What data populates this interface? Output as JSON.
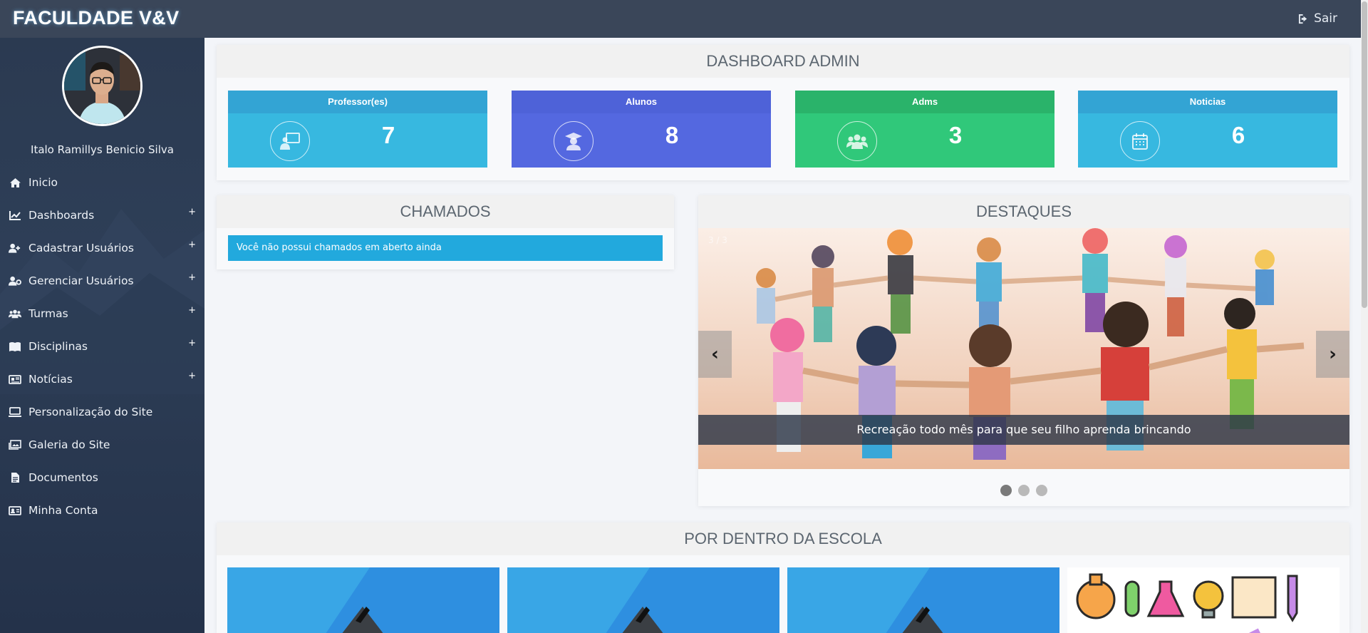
{
  "brand": "FACULDADE V&V",
  "logout_label": "Sair",
  "user": {
    "name": "Italo Ramillys Benicio Silva"
  },
  "menu": [
    {
      "label": "Inicio",
      "icon": "home-icon",
      "expandable": false
    },
    {
      "label": "Dashboards",
      "icon": "chart-line-icon",
      "expandable": true
    },
    {
      "label": "Cadastrar Usuários",
      "icon": "user-plus-icon",
      "expandable": true
    },
    {
      "label": "Gerenciar Usuários",
      "icon": "user-gear-icon",
      "expandable": true
    },
    {
      "label": "Turmas",
      "icon": "users-icon",
      "expandable": true
    },
    {
      "label": "Disciplinas",
      "icon": "book-icon",
      "expandable": true
    },
    {
      "label": "Notícias",
      "icon": "newspaper-icon",
      "expandable": true
    },
    {
      "label": "Personalização do Site",
      "icon": "laptop-icon",
      "expandable": false
    },
    {
      "label": "Galeria do Site",
      "icon": "gallery-icon",
      "expandable": false
    },
    {
      "label": "Documentos",
      "icon": "document-icon",
      "expandable": false
    },
    {
      "label": "Minha Conta",
      "icon": "id-card-icon",
      "expandable": false
    }
  ],
  "dashboard": {
    "title": "DASHBOARD ADMIN",
    "cards": [
      {
        "label": "Professor(es)",
        "value": "7",
        "icon": "teacher-icon",
        "head_color": "#33a4d4",
        "body_color": "#37b8e0"
      },
      {
        "label": "Alunos",
        "value": "8",
        "icon": "graduate-icon",
        "head_color": "#4e62d8",
        "body_color": "#5468e0"
      },
      {
        "label": "Adms",
        "value": "3",
        "icon": "users-icon",
        "head_color": "#2ab36a",
        "body_color": "#30c87a"
      },
      {
        "label": "Noticias",
        "value": "6",
        "icon": "calendar-icon",
        "head_color": "#33a4d4",
        "body_color": "#37b8e0"
      }
    ]
  },
  "chamados": {
    "title": "CHAMADOS",
    "message": "Você não possui chamados em aberto ainda"
  },
  "destaques": {
    "title": "DESTAQUES",
    "counter": "3 / 3",
    "caption": "Recreação todo mês para que seu filho aprenda brincando",
    "prev": "‹",
    "next": "›",
    "slide_count": 3,
    "active_slide": 1
  },
  "escola": {
    "title": "POR DENTRO DA ESCOLA"
  },
  "colors": {
    "topbar": "#3a4659",
    "sidebar": "#2c3b53",
    "alert": "#22a9dd"
  }
}
